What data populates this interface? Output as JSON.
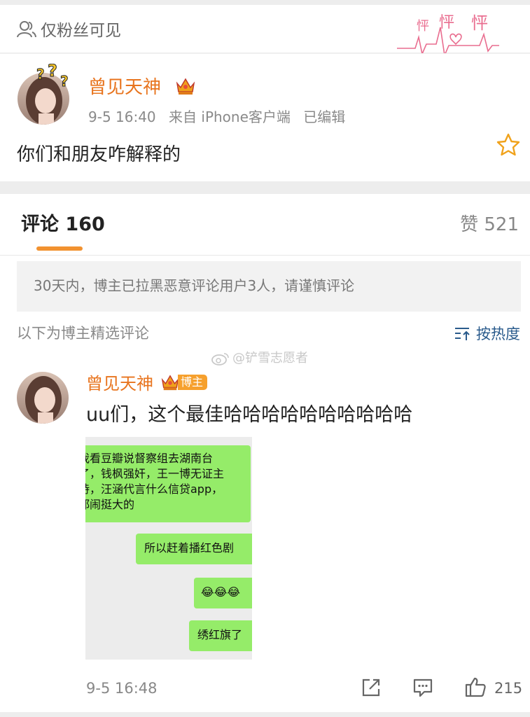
{
  "visibility": {
    "label": "仅粉丝可见",
    "icon": "users-icon"
  },
  "decoration": {
    "label": "怦怦怦",
    "icon": "heartbeat-doodle"
  },
  "post": {
    "author": "曾见天神",
    "time": "9-5 16:40",
    "source": "来自 iPhone客户端",
    "edited": "已编辑",
    "text": "你们和朋友咋解释的"
  },
  "tabs": {
    "comments_label": "评论",
    "comments_count": "160",
    "likes_label": "赞",
    "likes_count": "521"
  },
  "notice": "30天内，博主已拉黑恶意评论用户3人，请谨慎评论",
  "selected_label": "以下为博主精选评论",
  "sort_label": "按热度",
  "watermark": "@铲雪志愿者",
  "comment": {
    "author": "曾见天神",
    "badge": "博主",
    "text": "uu们，这个最佳哈哈哈哈哈哈哈哈哈哈",
    "time": "9-5 16:48",
    "likes": "215",
    "screenshot": {
      "message1": "我看豆瓣说督察组去湖南台\n了，钱枫强奸，王一博无证主\n持，汪涵代言什么信贷app，\n都闹挺大的",
      "message2": "所以赶着播红色剧",
      "message3": "😂😂😂",
      "message4": "绣红旗了"
    }
  },
  "colors": {
    "accent": "#f29230",
    "author": "#e8741e",
    "chat_bubble": "#95ec69",
    "link_blue": "#2a5b8c"
  }
}
